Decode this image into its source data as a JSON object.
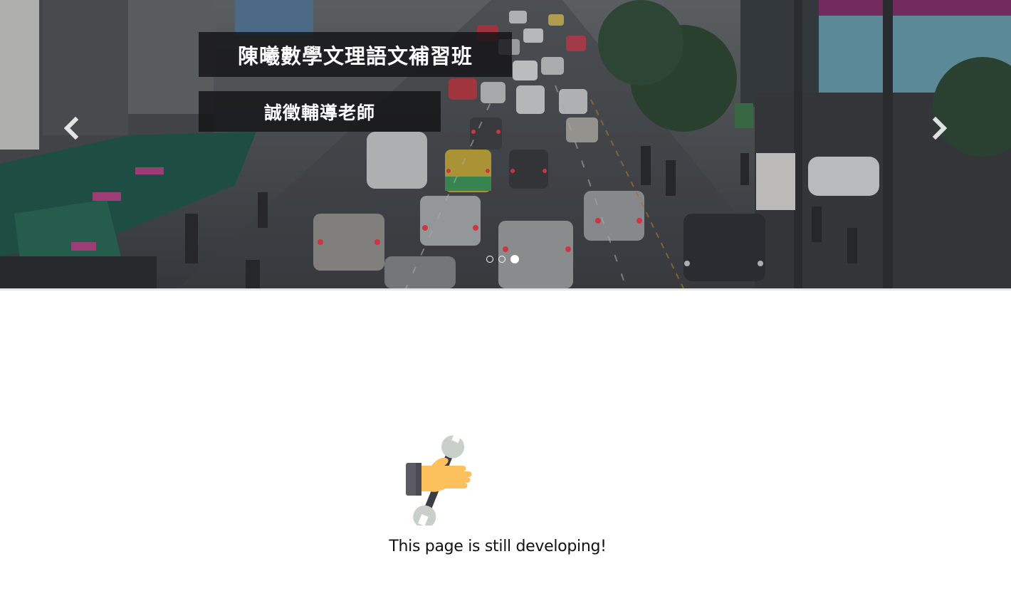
{
  "carousel": {
    "title": "陳曦數學文理語文補習班",
    "subtitle": "誠徵輔導老師",
    "prev_label": "Previous",
    "next_label": "Next",
    "slide_count": 3,
    "active_slide": 3,
    "background": "street-traffic-photo"
  },
  "notice": {
    "icon": "wrench-hand-icon",
    "message": "This page is still developing!"
  },
  "colors": {
    "caption_bg": "#141416",
    "caption_text": "#ffffff",
    "hand": "#fcc15c",
    "cuff": "#5b5b66",
    "wrench": "#c9cfc9"
  }
}
